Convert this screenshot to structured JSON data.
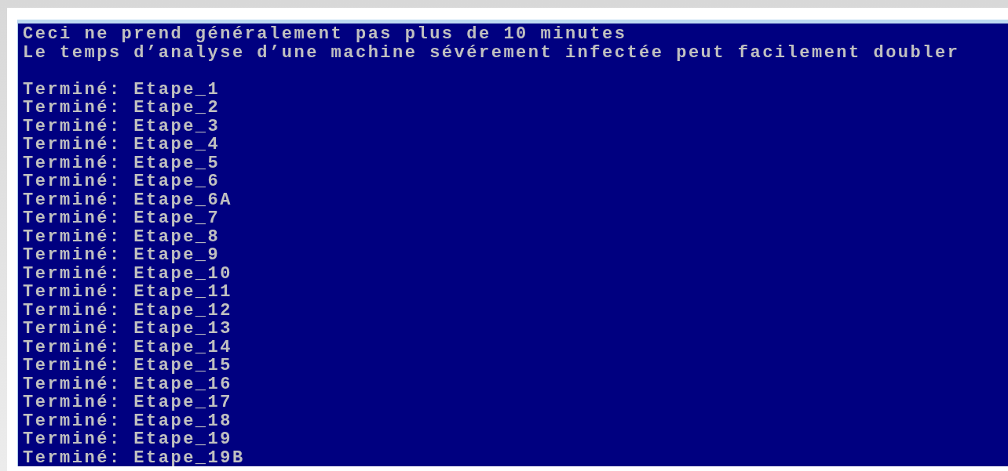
{
  "console": {
    "intro_lines": [
      "Ceci ne prend généralement pas plus de 10 minutes",
      "Le temps d’analyse d’une machine sévérement infectée peut facilement doubler"
    ],
    "step_lines": [
      "Terminé: Etape_1",
      "Terminé: Etape_2",
      "Terminé: Etape_3",
      "Terminé: Etape_4",
      "Terminé: Etape_5",
      "Terminé: Etape_6",
      "Terminé: Etape_6A",
      "Terminé: Etape_7",
      "Terminé: Etape_8",
      "Terminé: Etape_9",
      "Terminé: Etape_10",
      "Terminé: Etape_11",
      "Terminé: Etape_12",
      "Terminé: Etape_13",
      "Terminé: Etape_14",
      "Terminé: Etape_15",
      "Terminé: Etape_16",
      "Terminé: Etape_17",
      "Terminé: Etape_18",
      "Terminé: Etape_19",
      "Terminé: Etape_19B"
    ]
  }
}
